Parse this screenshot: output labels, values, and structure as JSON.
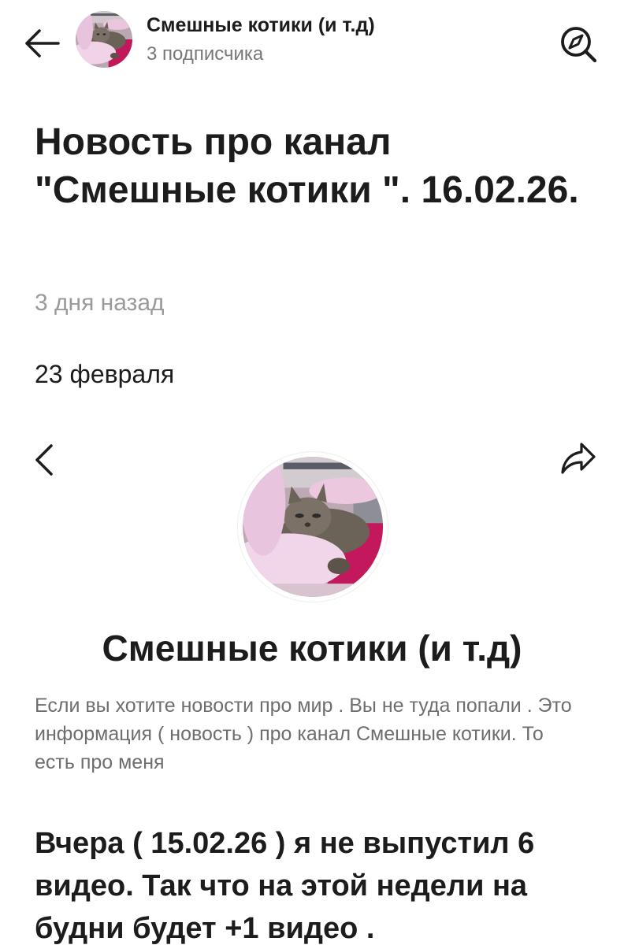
{
  "header": {
    "channel_name": "Смешные котики (и т.д)",
    "subscribers": "3 подписчика",
    "icons": {
      "back": "arrow-left-icon",
      "avatar": "cat-avatar",
      "explore": "compass-search-icon"
    }
  },
  "article": {
    "title": "Новость про канал \"Смешные котики \". 16.02.26.",
    "time_ago": "3 дня назад",
    "date": "23 февраля"
  },
  "channel_card": {
    "title": "Смешные котики (и т.д)",
    "description": "Если вы хотите новости про мир . Вы не туда попали . Это информация ( новость ) про канал Смешные котики. То есть про меня",
    "icons": {
      "prev": "chevron-left-icon",
      "share": "share-arrow-icon"
    }
  },
  "body": {
    "text": "Вчера ( 15.02.26 ) я не выпустил 6 видео. Так что на этой недели на будни будет +1 видео ."
  },
  "colors": {
    "text": "#1c1c1c",
    "muted": "#9a9a9a",
    "description": "#6e6e6e",
    "background": "#ffffff"
  }
}
